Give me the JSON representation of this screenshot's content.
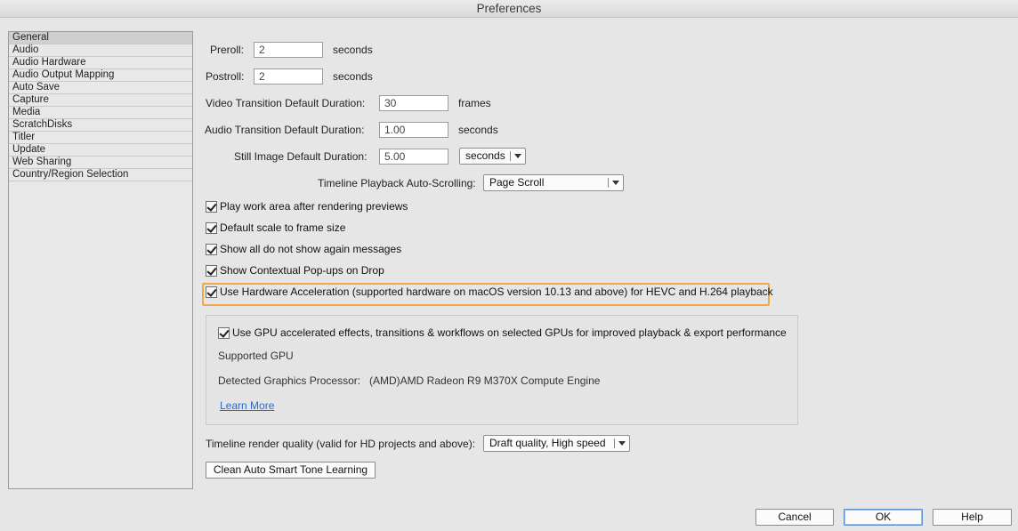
{
  "window": {
    "title": "Preferences"
  },
  "sidebar": {
    "items": [
      "General",
      "Audio",
      "Audio Hardware",
      "Audio Output Mapping",
      "Auto Save",
      "Capture",
      "Media",
      "ScratchDisks",
      "Titler",
      "Update",
      "Web Sharing",
      "Country/Region Selection"
    ],
    "selected": "General"
  },
  "general": {
    "preroll": {
      "label": "Preroll:",
      "value": "2",
      "unit": "seconds"
    },
    "postroll": {
      "label": "Postroll:",
      "value": "2",
      "unit": "seconds"
    },
    "video_transition": {
      "label": "Video Transition Default Duration:",
      "value": "30",
      "unit": "frames"
    },
    "audio_transition": {
      "label": "Audio Transition Default Duration:",
      "value": "1.00",
      "unit": "seconds"
    },
    "still_image": {
      "label": "Still Image Default Duration:",
      "value": "5.00",
      "unit_dropdown": "seconds"
    },
    "auto_scroll": {
      "label": "Timeline Playback Auto-Scrolling:",
      "value": "Page Scroll"
    },
    "checkboxes": [
      {
        "label": "Play work area after rendering previews",
        "checked": true
      },
      {
        "label": "Default scale to frame size",
        "checked": true
      },
      {
        "label": "Show all do not show again messages",
        "checked": true
      },
      {
        "label": "Show Contextual Pop-ups on Drop",
        "checked": true
      },
      {
        "label": "Use Hardware Acceleration (supported hardware on macOS version 10.13 and above) for HEVC and H.264 playback",
        "checked": true
      }
    ],
    "gpu": {
      "checkbox_label": "Use GPU accelerated effects, transitions & workflows on selected GPUs for improved playback & export performance",
      "checked": true,
      "supported_label": "Supported GPU",
      "detected_label": "Detected Graphics Processor:",
      "detected_value": "(AMD)AMD Radeon R9 M370X Compute Engine",
      "learn_more": "Learn More"
    },
    "render_quality": {
      "label": "Timeline render quality (valid for HD projects and above):",
      "value": "Draft quality, High speed"
    },
    "clean_button": "Clean Auto Smart Tone Learning"
  },
  "footer": {
    "cancel": "Cancel",
    "ok": "OK",
    "help": "Help"
  },
  "colors": {
    "highlight_border": "#f0a94a",
    "link": "#2c6ac8",
    "background": "#e6e6e6"
  }
}
